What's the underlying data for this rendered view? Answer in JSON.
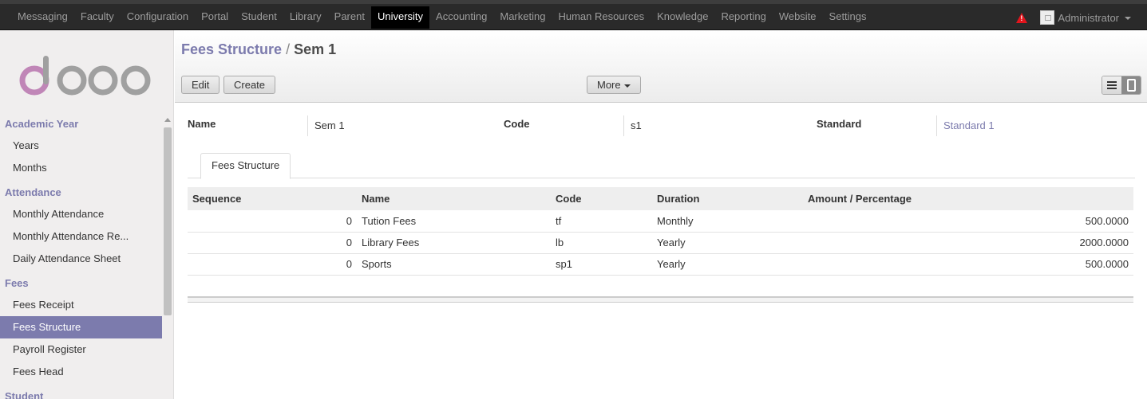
{
  "topbar": {
    "menus": [
      "Messaging",
      "Faculty",
      "Configuration",
      "Portal",
      "Student",
      "Library",
      "Parent",
      "University",
      "Accounting",
      "Marketing",
      "Human Resources",
      "Knowledge",
      "Reporting",
      "Website",
      "Settings"
    ],
    "active_menu": "University",
    "user": "Administrator"
  },
  "sidebar": {
    "sections": [
      {
        "title": "Academic Year",
        "items": [
          "Years",
          "Months"
        ]
      },
      {
        "title": "Attendance",
        "items": [
          "Monthly Attendance",
          "Monthly Attendance Re...",
          "Daily Attendance Sheet"
        ]
      },
      {
        "title": "Fees",
        "items": [
          "Fees Receipt",
          "Fees Structure",
          "Payroll Register",
          "Fees Head"
        ]
      },
      {
        "title": "Student",
        "items": []
      }
    ],
    "active_item": "Fees Structure"
  },
  "header": {
    "breadcrumb_link": "Fees Structure",
    "breadcrumb_sep": "/",
    "breadcrumb_current": "Sem 1",
    "edit_label": "Edit",
    "create_label": "Create",
    "more_label": "More"
  },
  "form": {
    "name_label": "Name",
    "name_value": "Sem 1",
    "code_label": "Code",
    "code_value": "s1",
    "standard_label": "Standard",
    "standard_value": "Standard 1",
    "tab_label": "Fees Structure"
  },
  "table": {
    "headers": [
      "Sequence",
      "Name",
      "Code",
      "Duration",
      "Amount / Percentage"
    ],
    "rows": [
      {
        "sequence": "0",
        "name": "Tution Fees",
        "code": "tf",
        "duration": "Monthly",
        "amount": "500.0000"
      },
      {
        "sequence": "0",
        "name": "Library Fees",
        "code": "lb",
        "duration": "Yearly",
        "amount": "2000.0000"
      },
      {
        "sequence": "0",
        "name": "Sports",
        "code": "sp1",
        "duration": "Yearly",
        "amount": "500.0000"
      }
    ]
  },
  "colors": {
    "accent": "#7c7bad",
    "topbar": "#2a2a2a",
    "warning": "#e2141c"
  },
  "icons": [
    "warning-icon",
    "avatar-icon",
    "caret-down-icon",
    "list-view-icon",
    "form-view-icon",
    "odoo-logo"
  ]
}
